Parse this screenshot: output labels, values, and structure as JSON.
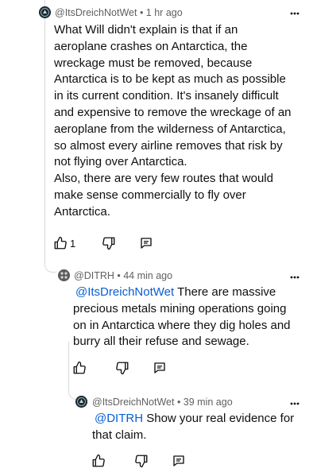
{
  "comments": [
    {
      "author": "@ItsDreichNotWet",
      "time": "• 1 hr ago",
      "body": "What Will didn't explain is that if an aeroplane crashes on Antarctica, the wreckage must be removed, because Antarctica is to be kept as much as possible in its current condition. It's insanely difficult and expensive to remove the wreckage of an aeroplane from the wilderness of Antarctica, so almost every airline removes that risk by not flying over Antarctica.\nAlso, there are very few routes that would make sense commercially to fly over Antarctica.",
      "like_count": "1",
      "avatar_icon": "dark-emblem-avatar-icon"
    },
    {
      "author": "@DITRH",
      "time": "• 44 min ago",
      "mention": "@ItsDreichNotWet",
      "body": "There are massive precious metals mining operations going on in Antarctica where they dig holes and burry all their refuse and sewage.",
      "avatar_icon": "grey-pattern-avatar-icon"
    },
    {
      "author": "@ItsDreichNotWet",
      "time": "• 39 min ago",
      "mention": "@DITRH",
      "body": "Show your real evidence for that claim.",
      "avatar_icon": "dark-emblem-avatar-icon"
    }
  ],
  "icons": {
    "like": "thumbs-up-icon",
    "dislike": "thumbs-down-icon",
    "reply": "reply-comment-icon",
    "more": "more-vertical-icon"
  },
  "colors": {
    "mention": "#065fd4",
    "meta": "#606060",
    "text": "#0f0f0f"
  }
}
